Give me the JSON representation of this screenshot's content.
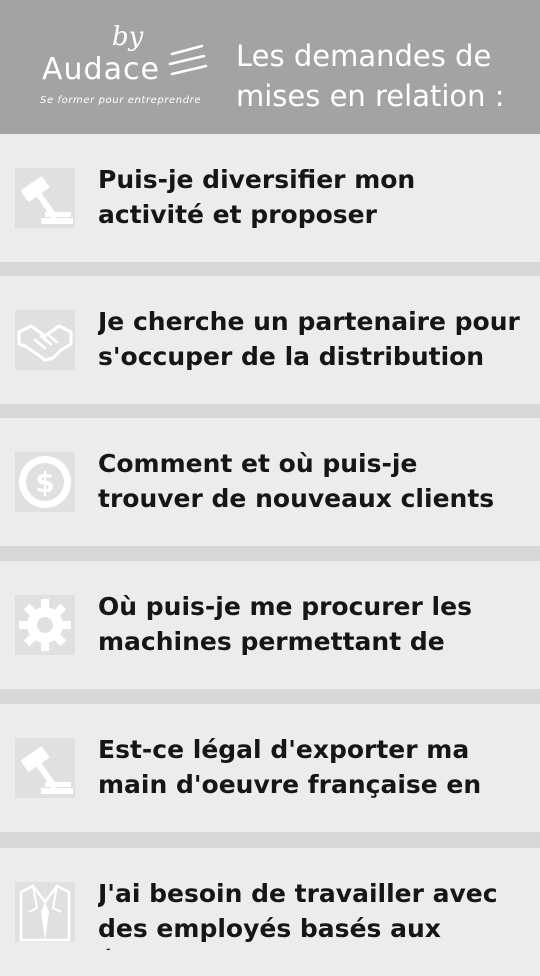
{
  "header": {
    "logo_by": "by",
    "logo_name": "Audace",
    "logo_tagline": "Se former pour entreprendre",
    "title": "Les demandes de mises en relation :"
  },
  "items": [
    {
      "icon": "gavel-icon",
      "text": "Puis-je diversifier mon activité et proposer également mes produits dans le secteur agricole ?"
    },
    {
      "icon": "handshake-icon",
      "text": "Je cherche un partenaire pour s'occuper de la distribution de mes produits."
    },
    {
      "icon": "dollar-coin-icon",
      "text": "Comment et où puis-je trouver de nouveaux clients dans la zone euro ou ailleurs ?"
    },
    {
      "icon": "gear-icon",
      "text": "Où puis-je me procurer les machines permettant de fabriquer mes produits ?"
    },
    {
      "icon": "gavel-icon",
      "text": "Est-ce légal d'exporter ma main d'oeuvre française en Corée du Nord ?"
    },
    {
      "icon": "suit-icon",
      "text": "J'ai besoin de travailler avec des employés basés aux États-Unis, comment faire ?"
    }
  ]
}
